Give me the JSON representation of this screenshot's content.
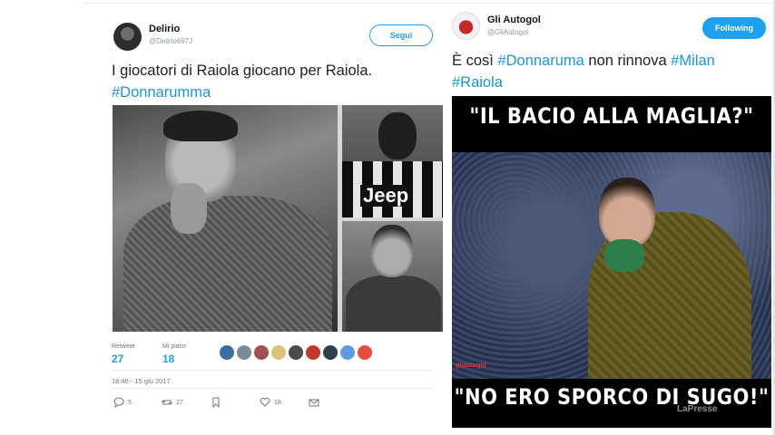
{
  "left_tweet": {
    "display_name": "Delirio",
    "handle": "@Delirio697J",
    "follow_label": "Segui",
    "text_line1": "I giocatori di Raiola giocano per Raiola.",
    "hashtag": "#Donnarumma",
    "retweets_label": "Retweet",
    "retweets_value": "27",
    "likes_label": "Mi piace",
    "likes_value": "18",
    "timestamp": "18:46 - 15 giu 2017",
    "reply_count": "5",
    "retweet_count": "27",
    "like_count": "18",
    "photo_jersey_text": "Jeep",
    "colors": {
      "link": "#1b95e0",
      "accent": "#1da1f2"
    },
    "liker_colors": [
      "#3a6ea5",
      "#7a8a99",
      "#a05050",
      "#d9c27a",
      "#4b4b4b",
      "#c0392b",
      "#2c3e50",
      "#5d9ce0",
      "#e74c3c"
    ]
  },
  "right_tweet": {
    "display_name": "Gli Autogol",
    "handle": "@GliAutogol",
    "following_label": "Following",
    "text_prefix": "È così ",
    "hashtag1": "#Donnaruma",
    "text_middle": " non rinnova ",
    "hashtag2": "#Milan",
    "hashtag3": "#Raiola",
    "meme_top_text": "\"IL BACIO ALLA MAGLIA?\"",
    "meme_bottom_text": "\"NO ERO SPORCO DI SUGO!\"",
    "meme_logo": "gliautogol",
    "watermark": "LaPresse"
  }
}
